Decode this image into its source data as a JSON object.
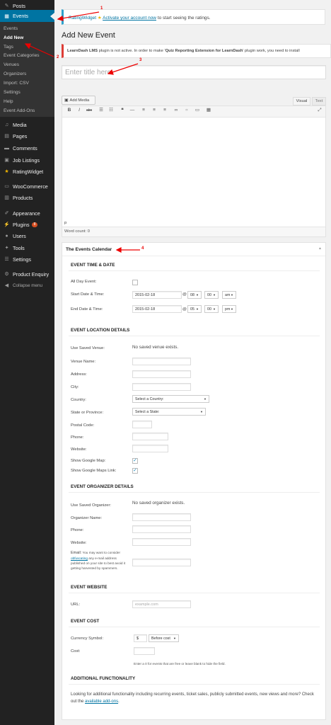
{
  "sidebar": {
    "posts": "Posts",
    "events": "Events",
    "submenu": [
      "Events",
      "Add New",
      "Tags",
      "Event Categories",
      "Venues",
      "Organizers",
      "Import: CSV",
      "Settings",
      "Help",
      "Event Add-Ons"
    ],
    "media": "Media",
    "pages": "Pages",
    "comments": "Comments",
    "job_listings": "Job Listings",
    "ratingwidget": "RatingWidget",
    "woocommerce": "WooCommerce",
    "products": "Products",
    "appearance": "Appearance",
    "plugins": "Plugins",
    "plugins_badge": "8",
    "users": "Users",
    "tools": "Tools",
    "settings": "Settings",
    "product_enquiry": "Product Enquiry",
    "collapse": "Collapse menu"
  },
  "notice1": {
    "brand": "RatingWidget",
    "star": "★",
    "link": "Activate your account now",
    "rest": "to start seeing the ratings."
  },
  "page_title": "Add New Event",
  "notice2": {
    "bold": "LearnDash LMS",
    "text1": "plugin is not active. In order to make '",
    "bold2": "Quiz Reporting Extension for LearnDash",
    "text2": "' plugin work, you need to install"
  },
  "title_placeholder": "Enter title here",
  "editor": {
    "add_media": "Add Media",
    "tab_visual": "Visual",
    "tab_text": "Text",
    "path": "p",
    "word_count": "Word count: 0"
  },
  "panel_title": "The Events Calendar",
  "time_date": {
    "heading": "EVENT TIME & DATE",
    "all_day": "All Day Event:",
    "start_label": "Start Date & Time:",
    "start_date": "2015-02-18",
    "start_hour": "08",
    "start_min": "00",
    "start_ampm": "am",
    "end_label": "End Date & Time:",
    "end_date": "2015-02-18",
    "end_hour": "05",
    "end_min": "00",
    "end_ampm": "pm",
    "at": "@"
  },
  "location": {
    "heading": "EVENT LOCATION DETAILS",
    "saved_venue": "Use Saved Venue:",
    "no_venue": "No saved venue exists.",
    "venue_name": "Venue Name:",
    "address": "Address:",
    "city": "City:",
    "country": "Country:",
    "country_value": "Select a Country:",
    "state": "State or Province:",
    "state_value": "Select a State:",
    "postal": "Postal Code:",
    "phone": "Phone:",
    "website": "Website:",
    "show_map": "Show Google Map:",
    "show_map_link": "Show Google Maps Link:"
  },
  "organizer": {
    "heading": "EVENT ORGANIZER DETAILS",
    "saved": "Use Saved Organizer:",
    "no_saved": "No saved organizer exists.",
    "name": "Organizer Name:",
    "phone": "Phone:",
    "website": "Website:",
    "email_label": "Email:",
    "email_note1": "You may want to consider",
    "email_link": "obfuscating",
    "email_note2": "any e-mail address published on your site to best avoid it getting harvested by spammers."
  },
  "website_section": {
    "heading": "EVENT WEBSITE",
    "url_label": "URL:",
    "url_placeholder": "example.com"
  },
  "cost": {
    "heading": "EVENT COST",
    "currency_label": "Currency Symbol:",
    "currency_value": "$",
    "position": "Before cost",
    "cost_label": "Cost:",
    "note": "Enter a 0 for events that are free or leave blank to hide the field."
  },
  "additional": {
    "heading": "ADDITIONAL FUNCTIONALITY",
    "text": "Looking for additional functionality including recurring events, ticket sales, publicly submitted events, new views and more? Check out the",
    "link": "available add-ons",
    "end": "."
  },
  "annotations": [
    "1",
    "2",
    "3",
    "4"
  ],
  "colors": {
    "sidebar_bg": "#222222",
    "active": "#0074a2",
    "annotation": "#ee0000",
    "link": "#0074a2"
  }
}
